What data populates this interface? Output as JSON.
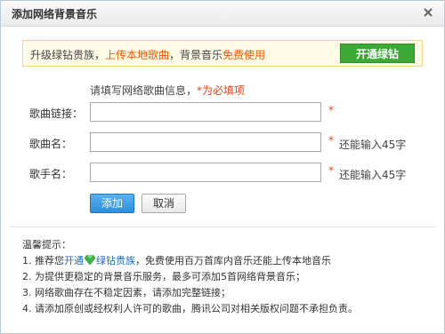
{
  "dialog": {
    "title": "添加网络背景音乐",
    "close_symbol": "×"
  },
  "banner": {
    "text_prefix": "升级绿钻贵族，",
    "text_highlight1": "上传本地歌曲",
    "text_middle": "，背景音乐",
    "text_highlight2": "免费使用",
    "button_label": "开通绿钻",
    "highlight_color": "#f05a00",
    "button_color": "#3aaa35"
  },
  "form": {
    "hint_text": "请填写网络歌曲信息，",
    "hint_required": "*为必填项",
    "fields": [
      {
        "label": "歌曲链接：",
        "value": "",
        "required_mark": "*",
        "remaining": ""
      },
      {
        "label": "歌曲名：",
        "value": "",
        "required_mark": "*",
        "remaining": "还能输入45字"
      },
      {
        "label": "歌手名：",
        "value": "",
        "required_mark": "*",
        "remaining": "还能输入45字"
      }
    ],
    "add_button": "添加",
    "cancel_button": "取消"
  },
  "tips": {
    "title": "温馨提示：",
    "line1_prefix": "1. 推荐您",
    "line1_link1": "开通",
    "line1_link2": "绿钻贵族",
    "line1_suffix": "，免费使用百万首库内音乐还能上传本地音乐",
    "line2": "2. 为提供更稳定的背景音乐服务，最多可添加5首网络背景音乐；",
    "line3": "3. 网络歌曲存在不稳定因素，请添加完整链接；",
    "line4": "4. 请添加原创或经权利人许可的歌曲，腾讯公司对相关版权问题不承担负责。"
  }
}
